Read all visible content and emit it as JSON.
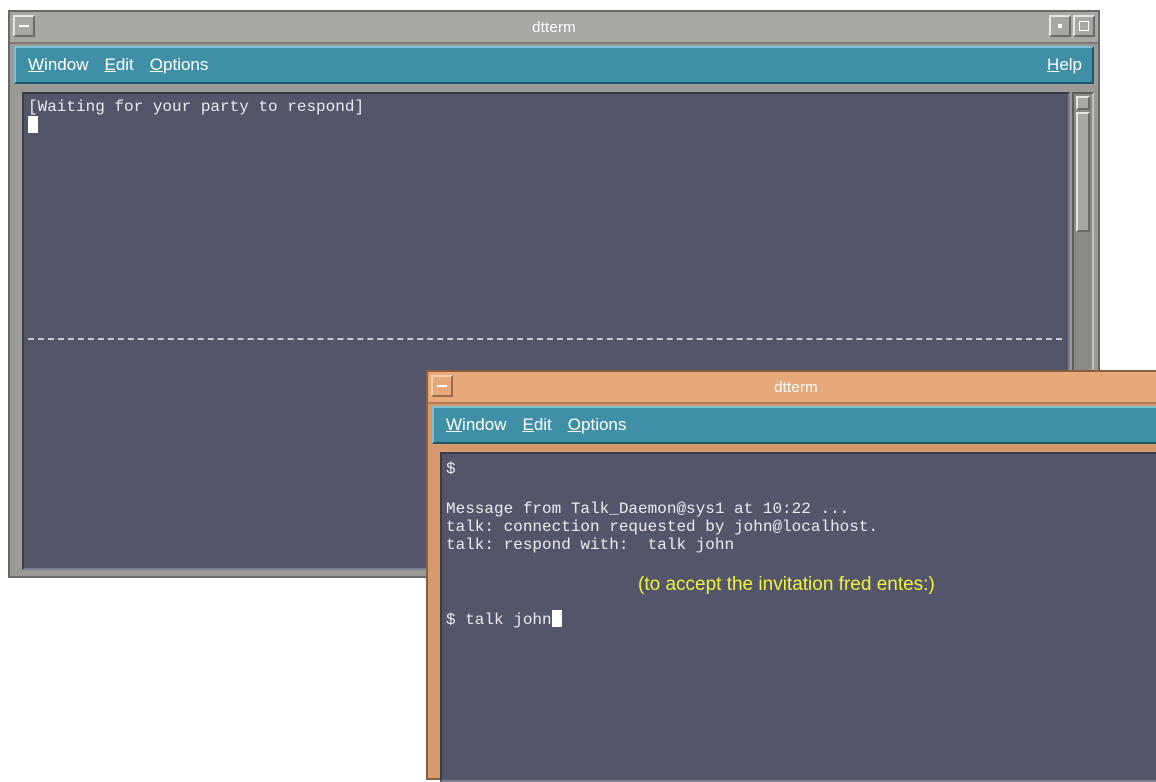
{
  "window_back": {
    "title": "dtterm",
    "menu": {
      "window": "Window",
      "edit": "Edit",
      "options": "Options",
      "help": "Help"
    },
    "terminal": {
      "line1": "[Waiting for your party to respond]"
    }
  },
  "window_front": {
    "title": "dtterm",
    "menu": {
      "window": "Window",
      "edit": "Edit",
      "options": "Options"
    },
    "terminal": {
      "line1": "$",
      "line2": "Message from Talk_Daemon@sys1 at 10:22 ...",
      "line3": "talk: connection requested by john@localhost.",
      "line4": "talk: respond with:  talk john",
      "annotation": "(to accept the invitation fred entes:)",
      "line5": "$ talk john"
    }
  },
  "colors": {
    "terminal_bg": "#53556a",
    "menubar_bg": "#3f8fa6",
    "back_frame": "#a9a7a3",
    "front_frame": "#e7a97a",
    "annotation_text": "#f2f23c"
  },
  "icons": [
    "window-menu-icon",
    "minimize-icon",
    "maximize-icon",
    "scroll-up-arrow-icon"
  ]
}
